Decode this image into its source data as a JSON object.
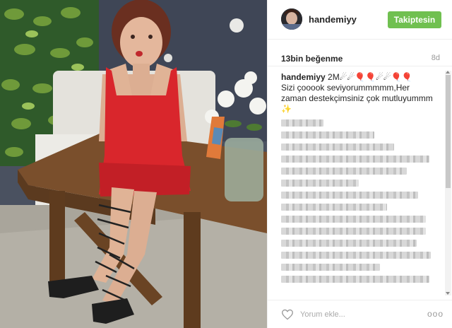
{
  "header": {
    "username": "handemiyy",
    "follow_label": "Takiptesin"
  },
  "stats": {
    "likes": "13bin beğenme",
    "age": "8d"
  },
  "caption": {
    "user": "handemiyy",
    "line1_rest": " 2M☄☄🎈🎈☄☄🎈🎈",
    "line2": "Sizi çooook seviyorummmmm,Her",
    "line3": "zaman destekçimsiniz çok mutluyummm",
    "line4": "✨"
  },
  "footer": {
    "comment_placeholder": "Yorum ekle...",
    "more_label": "ooo"
  },
  "icons": {
    "like": "heart-outline-icon",
    "more": "more-options-icon"
  },
  "colors": {
    "follow_button": "#70c050",
    "text": "#262626",
    "muted": "#999999"
  }
}
